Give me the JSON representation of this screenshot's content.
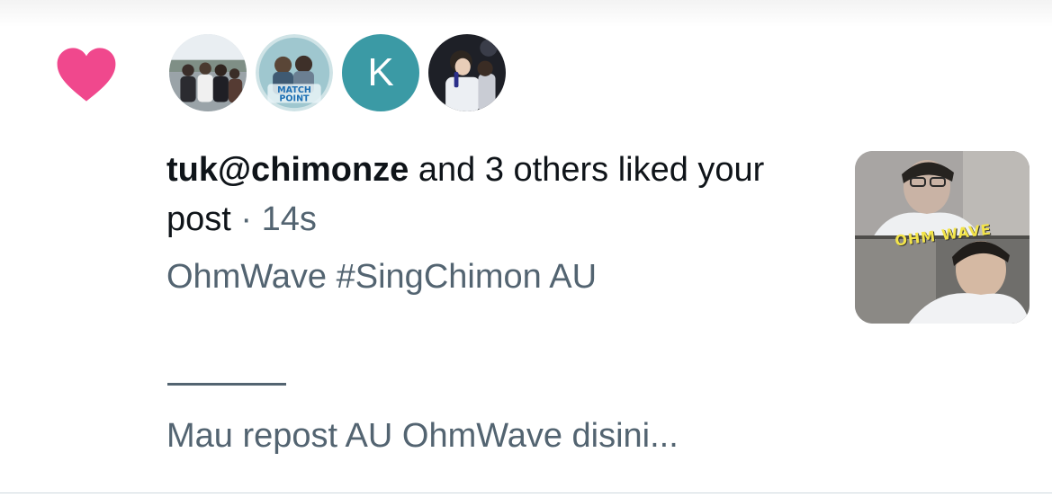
{
  "notification": {
    "icon": "heart-icon",
    "icon_color": "#f0488d",
    "avatars": [
      {
        "kind": "photo",
        "name": "group-photo-avatar"
      },
      {
        "kind": "logo",
        "text": "MATCH POINT"
      },
      {
        "kind": "letter",
        "letter": "K",
        "color": "#3b9aa5"
      },
      {
        "kind": "photo",
        "name": "concert-photo-avatar"
      }
    ],
    "user": "tuk@chimonze",
    "action": " and 3 others liked your post",
    "separator": " · ",
    "time": "14s",
    "post_title": "OhmWave #SingChimon AU",
    "thumbnail_caption": "OHM WAVE",
    "snippet": "Mau repost AU OhmWave disini..."
  }
}
